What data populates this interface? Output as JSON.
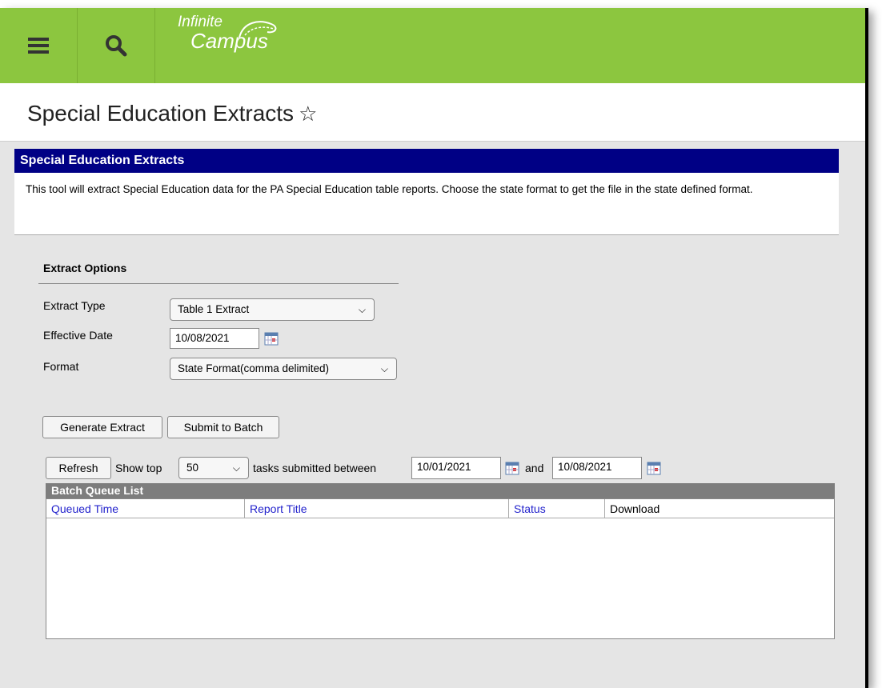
{
  "app": {
    "logo_line1": "Infinite",
    "logo_line2": "Campus"
  },
  "page": {
    "title": "Special Education Extracts",
    "star": "☆"
  },
  "section": {
    "header": "Special Education Extracts",
    "description": "This tool will extract Special Education data for the PA Special Education table reports. Choose the state format to get the file in the state defined format."
  },
  "options": {
    "title": "Extract Options",
    "extract_type_label": "Extract Type",
    "extract_type_value": "Table 1 Extract",
    "effective_date_label": "Effective Date",
    "effective_date_value": "10/08/2021",
    "format_label": "Format",
    "format_value": "State Format(comma delimited)"
  },
  "actions": {
    "generate": "Generate Extract",
    "submit": "Submit to Batch"
  },
  "queue_filter": {
    "refresh": "Refresh",
    "show_top": "Show top",
    "top_value": "50",
    "between_text": "tasks submitted between",
    "start_date": "10/01/2021",
    "and_text": "and",
    "end_date": "10/08/2021"
  },
  "batch_queue": {
    "title": "Batch Queue List",
    "columns": [
      "Queued Time",
      "Report Title",
      "Status",
      "Download"
    ]
  },
  "colors": {
    "topbar": "#8cc63f",
    "section_header": "#000085",
    "link": "#2222cc"
  },
  "icons": {
    "menu": "hamburger-menu-icon",
    "search": "search-icon",
    "calendar": "calendar-icon",
    "chevron": "chevron-down-icon"
  }
}
